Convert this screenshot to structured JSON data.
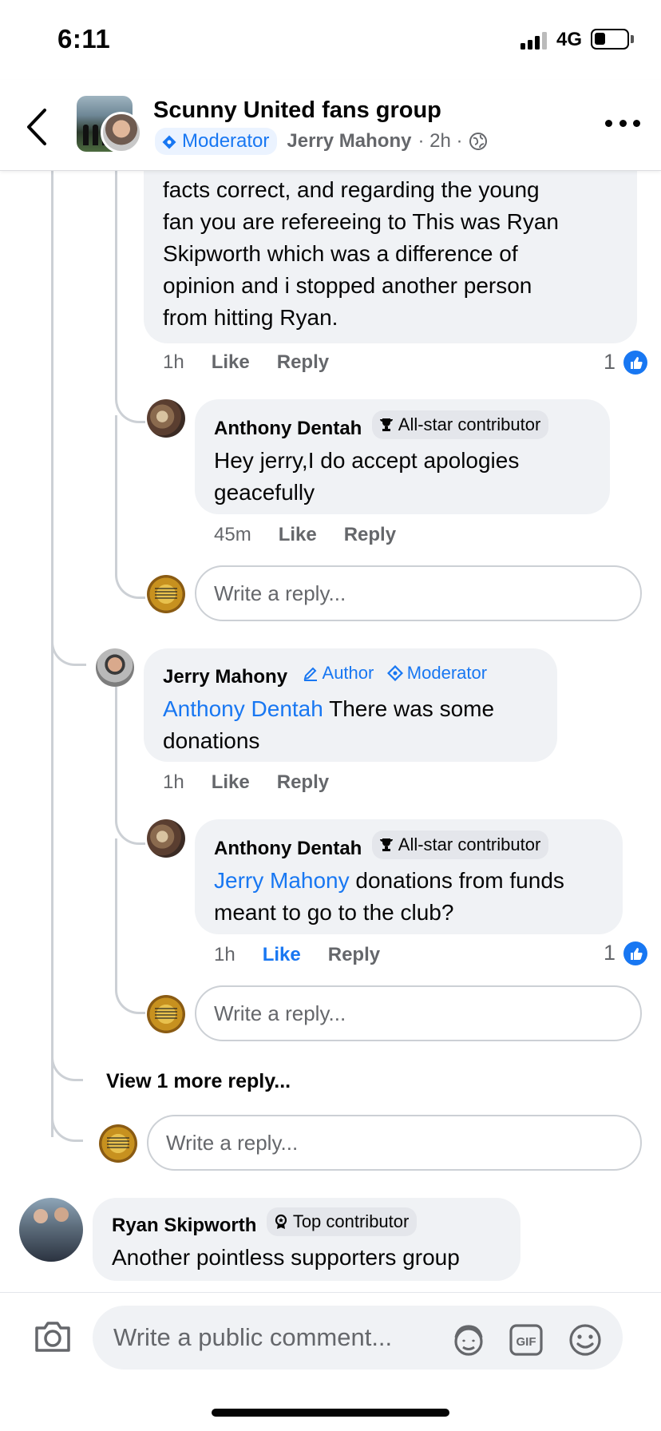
{
  "status_bar": {
    "time": "6:11",
    "network": "4G",
    "battery_level": 0.35
  },
  "header": {
    "group_name": "Scunny United fans group",
    "badge": "Moderator",
    "author": "Jerry Mahony",
    "meta": "· 2h ·",
    "icons": [
      "back-arrow-icon",
      "globe-icon",
      "more-icon"
    ]
  },
  "comments": {
    "first_tail": {
      "text": "facts correct, and regarding the young fan you are refereeing to This was Ryan Skipworth which was  a difference of opinion and i stopped another person from hitting Ryan.",
      "lines": [
        "facts correct, and regarding the young",
        "fan you are refereeing to This was Ryan",
        "Skipworth which was  a difference of",
        "opinion and i stopped another person",
        "from hitting Ryan."
      ],
      "time": "1h",
      "like": "Like",
      "reply": "Reply",
      "reactions": "1"
    },
    "anthony_1": {
      "name": "Anthony Dentah",
      "badge": "All-star contributor",
      "lines": [
        "Hey jerry,I do accept apologies",
        "geacefully"
      ],
      "time": "45m",
      "like": "Like",
      "reply": "Reply"
    },
    "reply_placeholder": "Write a reply...",
    "jerry": {
      "name": "Jerry Mahony",
      "author_badge": "Author",
      "mod_badge": "Moderator",
      "mention": "Anthony Dentah",
      "line1_rest": " There was some",
      "line2": "donations",
      "time": "1h",
      "like": "Like",
      "reply": "Reply"
    },
    "anthony_2": {
      "name": "Anthony Dentah",
      "badge": "All-star contributor",
      "mention": "Jerry Mahony",
      "line1_rest": " donations from funds",
      "line2": "meant to go to the club?",
      "time": "1h",
      "like": "Like",
      "reply": "Reply",
      "reactions": "1"
    },
    "view_more": "View 1 more reply...",
    "ryan": {
      "name": "Ryan Skipworth",
      "badge": "Top contributor",
      "text": "Another pointless supporters group"
    }
  },
  "composer": {
    "placeholder": "Write a public comment...",
    "icons": [
      "camera-icon",
      "avatar-sticker-icon",
      "gif-icon",
      "emoji-icon"
    ],
    "gif_label": "GIF"
  },
  "colors": {
    "accent": "#1877f2",
    "bubble": "#f0f2f5",
    "secondary_text": "#65676b",
    "thread_line": "#ccd0d5"
  }
}
